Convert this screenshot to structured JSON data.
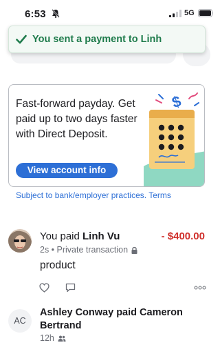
{
  "status_bar": {
    "time": "6:53",
    "network": "5G"
  },
  "toast": {
    "message": "You sent a payment to Linh"
  },
  "promo": {
    "headline": "Fast-forward payday. Get paid up to two days faster with Direct Deposit.",
    "button_label": "View account info"
  },
  "disclaimer": "Subject to bank/employer practices. Terms",
  "feed": {
    "items": [
      {
        "prefix": "You paid",
        "name": "Linh Vu",
        "amount": "- $400.00",
        "time": "2s",
        "visibility": "Private transaction",
        "note": "product"
      },
      {
        "avatar_initials": "AC",
        "title": "Ashley Conway paid Cameron Bertrand",
        "time": "12h"
      }
    ]
  },
  "colors": {
    "accent": "#2d6fd6",
    "success": "#1e7b4b",
    "negative_amount": "#d0312d"
  }
}
